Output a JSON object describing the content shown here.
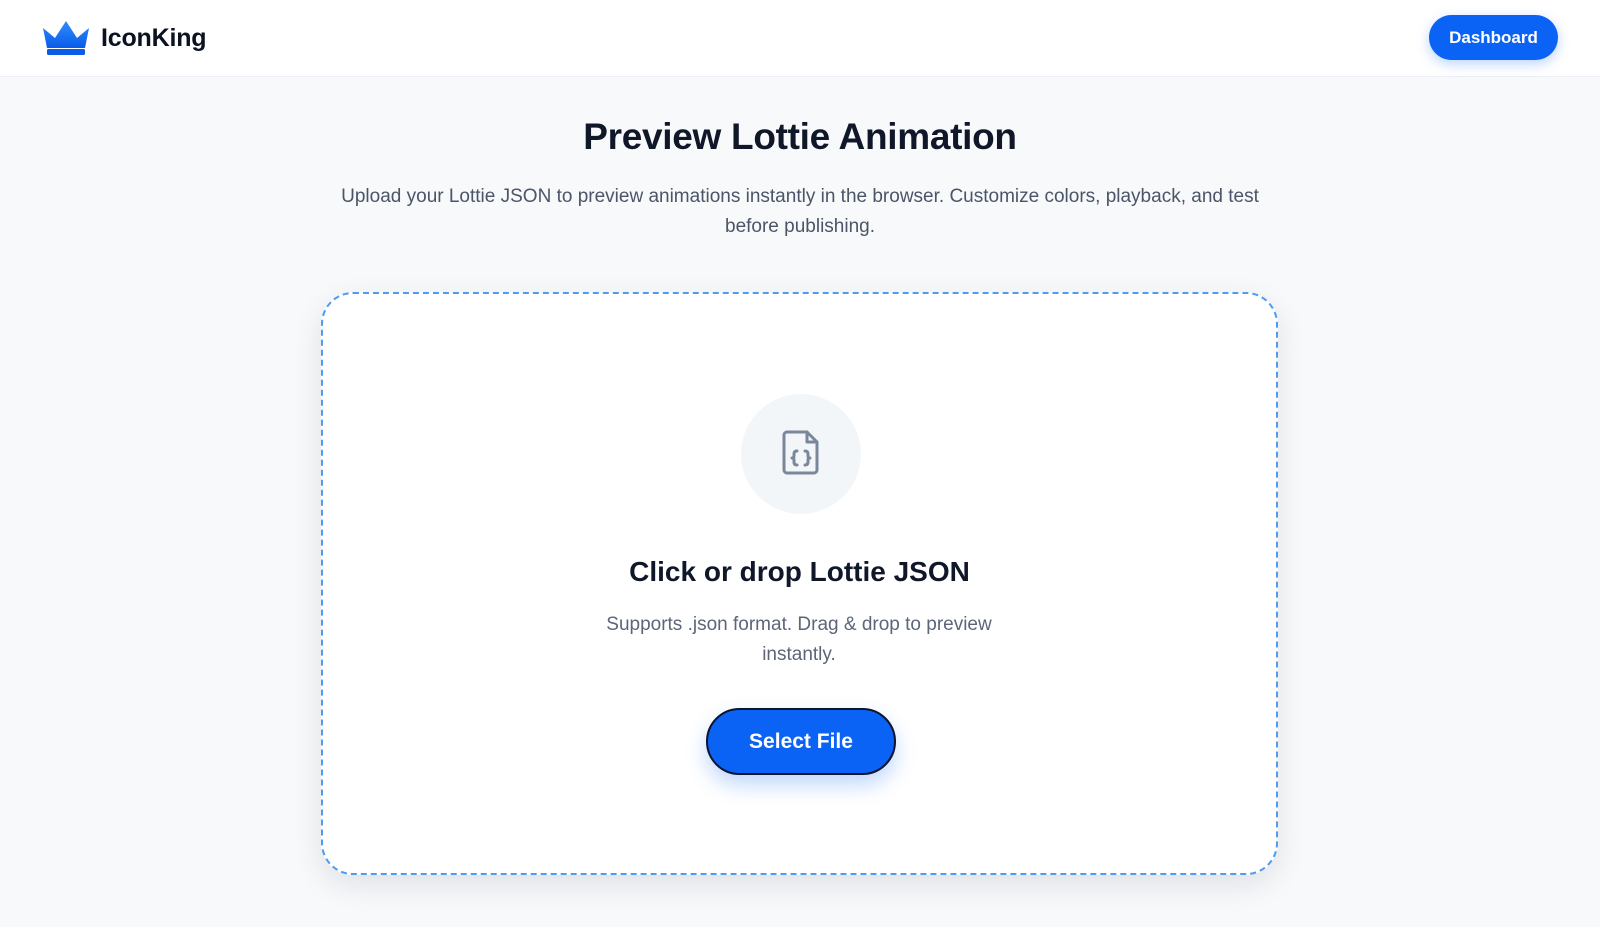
{
  "header": {
    "brand_name": "IconKing",
    "dashboard_label": "Dashboard"
  },
  "hero": {
    "title": "Preview Lottie Animation",
    "subtitle": "Upload your Lottie JSON to preview animations instantly in the browser. Customize colors, playback, and test before publishing."
  },
  "dropzone": {
    "icon": "file-json-icon",
    "title": "Click or drop Lottie JSON",
    "description": "Supports .json format. Drag & drop to preview instantly.",
    "button_label": "Select File"
  },
  "colors": {
    "accent": "#0b63f6",
    "dropzone_border": "#4f9bf0",
    "background": "#f7f9fb",
    "text_primary": "#0f1729",
    "text_secondary": "#4b5567",
    "icon_gray": "#7a8699"
  }
}
